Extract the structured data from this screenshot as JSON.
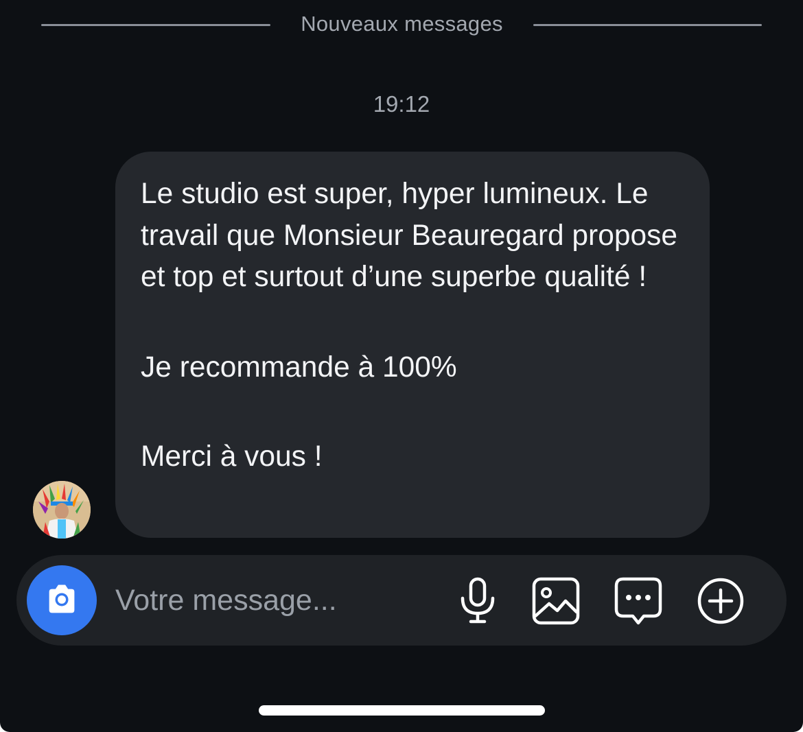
{
  "conversation": {
    "new_messages_divider": "Nouveaux messages",
    "timestamp": "19:12",
    "message": {
      "paragraphs": [
        "Le studio est super, hyper lumineux. Le travail que Monsieur Beauregard propose et top et surtout d’une superbe qualité !",
        "Je recommande à 100%",
        "Merci à vous !"
      ]
    }
  },
  "composer": {
    "placeholder": "Votre message...",
    "value": "",
    "accent_color": "#3478f0",
    "icons": [
      "camera-icon",
      "microphone-icon",
      "image-icon",
      "sticker-chat-icon",
      "plus-circle-icon"
    ]
  },
  "theme": {
    "background": "#0d1014",
    "bubble": "#25282d",
    "composer": "#1f2226"
  }
}
